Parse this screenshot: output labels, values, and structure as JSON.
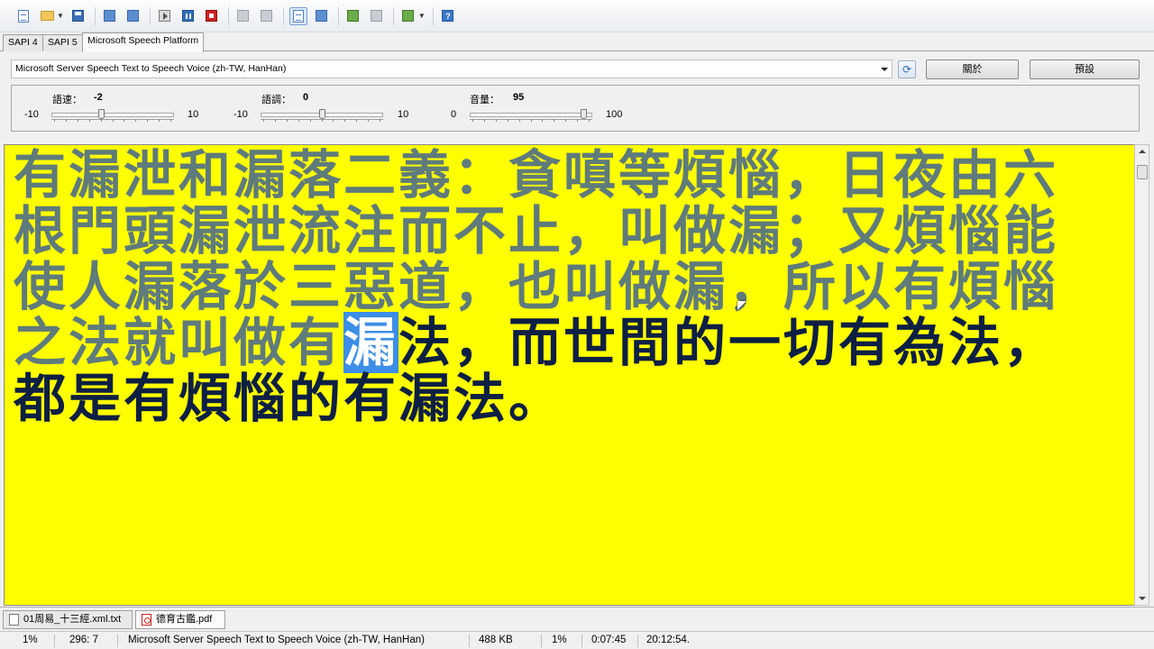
{
  "toolbar": {
    "buttons": [
      "new-document-icon",
      "open-folder-icon",
      "save-icon",
      "batch-icon",
      "convert-icon",
      "play-icon",
      "pause-icon",
      "stop-icon",
      "copy-icon",
      "paste-icon",
      "highlight-icon",
      "speak-icon",
      "file-prev-icon",
      "file-next-icon",
      "tools-icon",
      "help-icon"
    ],
    "help_glyph": "?"
  },
  "tabs": [
    {
      "label": "SAPI 4",
      "active": false
    },
    {
      "label": "SAPI 5",
      "active": false
    },
    {
      "label": "Microsoft Speech Platform",
      "active": true
    }
  ],
  "voice": {
    "selected": "Microsoft Server Speech Text to Speech Voice (zh-TW, HanHan)",
    "about_label": "關於",
    "default_label": "預設"
  },
  "sliders": {
    "rate": {
      "label": "語速：",
      "value": "-2",
      "min": "-10",
      "max": "10",
      "level": 0.4
    },
    "pitch": {
      "label": "語調：",
      "value": "0",
      "min": "-10",
      "max": "10",
      "level": 0.5
    },
    "volume": {
      "label": "音量：",
      "value": "95",
      "min": "0",
      "max": "100",
      "level": 0.95
    }
  },
  "editor": {
    "text_read": "有漏泄和漏落二義：貪嗔等煩惱，日夜由六根門頭漏泄流注而不止，叫做漏；又煩惱能使人漏落於三惡道，也叫做漏，所以有煩惱之法就叫做有",
    "text_current": "漏",
    "text_unread": "法，而世間的一切有為法，都是有煩惱的有漏法。",
    "background": "#ffff00",
    "read_color": "#5f7b7b",
    "highlight_color": "#3c8ee6",
    "unread_color": "#0e1f44"
  },
  "documents": [
    {
      "name": "01周易_十三經.xml.txt",
      "type": "txt-file-icon",
      "active": false
    },
    {
      "name": "德育古鑑.pdf",
      "type": "pdf-file-icon",
      "active": true
    }
  ],
  "status": {
    "percent": "1%",
    "position": "296:  7",
    "voice": "Microsoft Server Speech Text to Speech Voice (zh-TW, HanHan)",
    "size": "488 KB",
    "progress": "1%",
    "elapsed": "0:07:45",
    "clock": "20:12:54."
  }
}
